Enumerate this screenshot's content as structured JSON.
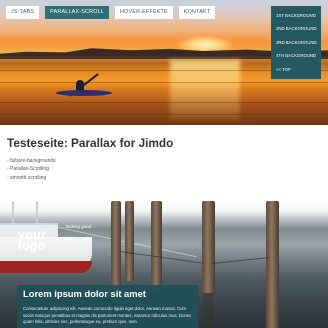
{
  "nav": {
    "tabs": [
      {
        "label": "JS-TABS",
        "active": false
      },
      {
        "label": "PARALLAX-SCROLL",
        "active": true
      },
      {
        "label": "HOVER-EFFEKTE",
        "active": false
      },
      {
        "label": "KONTAKT",
        "active": false
      }
    ],
    "accent_color": "#2e6e78"
  },
  "subnav": {
    "items": [
      "1ST BACKGROUND",
      "2ND BACKGROUND",
      "3RD BACKGROUND",
      "4TH BACKGROUND",
      "<< TOP"
    ]
  },
  "content": {
    "title": "Testeseite: Parallax for Jimdo",
    "features": [
      "- fullsize-backgrounds",
      "- Parallax-Scrolling",
      "- smooth scrolling"
    ]
  },
  "branding": {
    "logo_text_line1": "your",
    "logo_text_line2": "logo",
    "tagline": "...looking good"
  },
  "overlay": {
    "title": "Lorem ipsum dolor sit amet",
    "body": "Consectetuer adipiscing elit. Aenean commodo ligula eget dolor. Aenean massa. Cum sociis natoque penatibus et magnis dis parturient montes, nascetur ridiculus mus. Donec quam felis, ultricies nec, pellentesque eu, pretium quis, sem."
  }
}
